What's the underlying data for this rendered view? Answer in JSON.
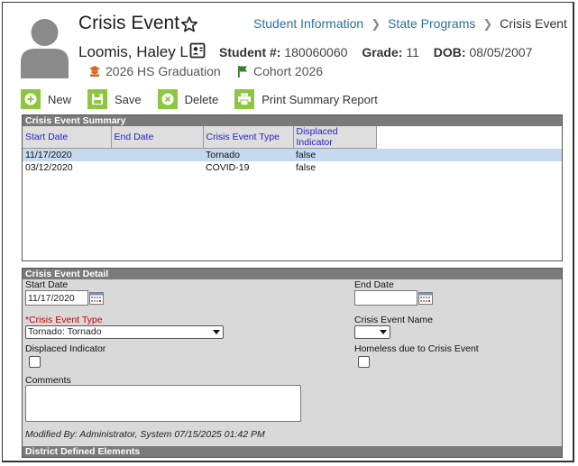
{
  "header": {
    "title": "Crisis Event",
    "breadcrumb": [
      "Student Information",
      "State Programs",
      "Crisis Event"
    ]
  },
  "student": {
    "name": "Loomis, Haley L",
    "student_number_label": "Student #:",
    "student_number": "180060060",
    "grade_label": "Grade:",
    "grade": "11",
    "dob_label": "DOB:",
    "dob": "08/05/2007",
    "graduation": "2026 HS Graduation",
    "cohort": "Cohort 2026"
  },
  "toolbar": {
    "new_label": "New",
    "save_label": "Save",
    "delete_label": "Delete",
    "print_label": "Print Summary Report"
  },
  "summary": {
    "title": "Crisis Event Summary",
    "columns": [
      "Start Date",
      "End Date",
      "Crisis Event Type",
      "Displaced Indicator"
    ],
    "rows": [
      {
        "start": "11/17/2020",
        "end": "",
        "type": "Tornado",
        "displaced": "false"
      },
      {
        "start": "03/12/2020",
        "end": "",
        "type": "COVID-19",
        "displaced": "false"
      }
    ]
  },
  "detail": {
    "title": "Crisis Event Detail",
    "start_date_label": "Start Date",
    "start_date_value": "11/17/2020",
    "end_date_label": "End Date",
    "end_date_value": "",
    "event_type_label": "*Crisis Event Type",
    "event_type_value": "Tornado: Tornado",
    "event_name_label": "Crisis Event Name",
    "event_name_value": "",
    "displaced_label": "Displaced Indicator",
    "homeless_label": "Homeless due to Crisis Event",
    "comments_label": "Comments",
    "comments_value": "",
    "modified": "Modified By: Administrator, System 07/15/2025 01:42 PM"
  },
  "district": {
    "title": "District Defined Elements"
  },
  "colors": {
    "accent_green": "#8dc63f",
    "link_blue": "#2e6fa0",
    "header_gray": "#7a7a7a",
    "selected_row": "#c5d9f1",
    "required_red": "#cc0000"
  }
}
